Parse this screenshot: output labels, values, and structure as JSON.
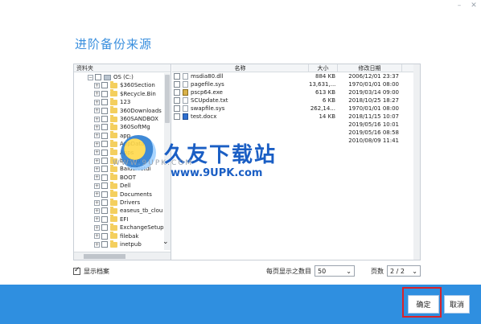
{
  "window_controls": {
    "minimize": "–",
    "close": "✕"
  },
  "dialog": {
    "title": "进阶备份来源"
  },
  "tree": {
    "header": "资料夹",
    "items": [
      {
        "label": "OS (C:)",
        "type": "drive"
      },
      {
        "label": "$360Section",
        "type": "folder"
      },
      {
        "label": "$Recycle.Bin",
        "type": "folder"
      },
      {
        "label": "123",
        "type": "folder"
      },
      {
        "label": "360Downloads",
        "type": "folder"
      },
      {
        "label": "360SANDBOX",
        "type": "folder"
      },
      {
        "label": "360SoftMg",
        "type": "folder"
      },
      {
        "label": "app",
        "type": "folder"
      },
      {
        "label": "AppData",
        "type": "folder"
      },
      {
        "label": "Apps",
        "type": "folder"
      },
      {
        "label": "backup",
        "type": "folder"
      },
      {
        "label": "BaiduNetdi",
        "type": "folder"
      },
      {
        "label": "BOOT",
        "type": "folder"
      },
      {
        "label": "Dell",
        "type": "folder"
      },
      {
        "label": "Documents",
        "type": "folder"
      },
      {
        "label": "Drivers",
        "type": "folder"
      },
      {
        "label": "easeus_tb_clou",
        "type": "folder"
      },
      {
        "label": "EFI",
        "type": "folder"
      },
      {
        "label": "ExchangeSetup",
        "type": "folder"
      },
      {
        "label": "filebak",
        "type": "folder"
      },
      {
        "label": "inetpub",
        "type": "folder"
      }
    ]
  },
  "files": {
    "headers": {
      "name": "名称",
      "size": "大小",
      "date": "修改日期"
    },
    "rows": [
      {
        "name": "msdia80.dll",
        "size": "884 KB",
        "date": "2006/12/01 23:37",
        "icon": "file"
      },
      {
        "name": "pagefile.sys",
        "size": "13,631,...",
        "date": "1970/01/01 08:00",
        "icon": "file"
      },
      {
        "name": "pscp64.exe",
        "size": "613 KB",
        "date": "2019/03/14 09:00",
        "icon": "exe"
      },
      {
        "name": "SCUpdate.txt",
        "size": "6 KB",
        "date": "2018/10/25 18:27",
        "icon": "file"
      },
      {
        "name": "swapfile.sys",
        "size": "262,14...",
        "date": "1970/01/01 08:00",
        "icon": "file"
      },
      {
        "name": "test.docx",
        "size": "14 KB",
        "date": "2018/11/15 10:07",
        "icon": "doc"
      },
      {
        "name": "",
        "size": "",
        "date": "2019/05/16 10:01",
        "icon": ""
      },
      {
        "name": "",
        "size": "",
        "date": "2019/05/16 08:58",
        "icon": ""
      },
      {
        "name": "",
        "size": "",
        "date": "2010/08/09 11:41",
        "icon": ""
      }
    ]
  },
  "footer": {
    "show_archive_label": "显示档案",
    "per_page_label": "每页显示之数目",
    "per_page_value": "50",
    "page_label": "页数",
    "page_value": "2 / 2"
  },
  "buttons": {
    "ok": "确定",
    "cancel": "取消"
  },
  "watermark": {
    "cn": "久友下载站",
    "url": "www.9UPK.com",
    "left": "WWW.9UPK.COM"
  },
  "colors": {
    "accent": "#2f8fe0",
    "title": "#3a8fde",
    "highlight": "#d9232b"
  }
}
